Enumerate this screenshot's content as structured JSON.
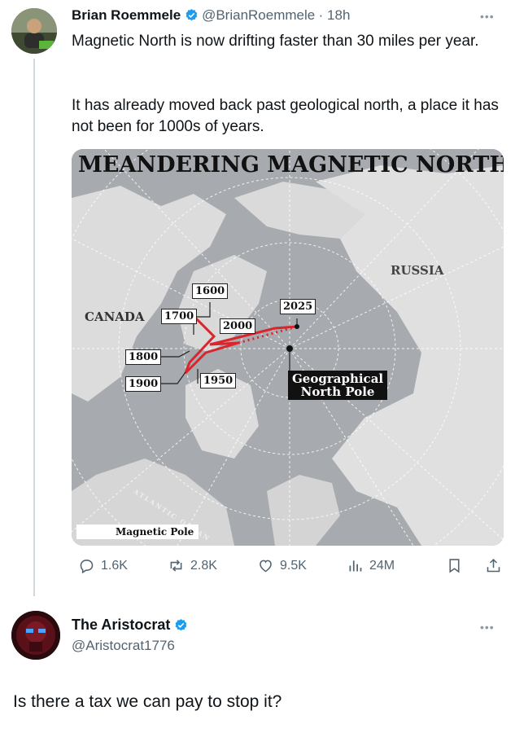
{
  "tweet": {
    "author_name": "Brian Roemmele",
    "author_handle": "@BrianRoemmele",
    "time": "· 18h",
    "text_p1": "Magnetic North is now drifting faster than 30 miles per year.",
    "text_p2": "It has already moved back past geological north, a place it has not been for 1000s of years.",
    "image": {
      "title": "MEANDERING MAGNETIC NORTH",
      "labels": {
        "canada": "CANADA",
        "russia": "RUSSIA",
        "atlantic": "ATLANTIC OCEAN",
        "geo_line1": "Geographical",
        "geo_line2": "North Pole",
        "y1600": "1600",
        "y1700": "1700",
        "y1800": "1800",
        "y1900": "1900",
        "y1950": "1950",
        "y2000": "2000",
        "y2025": "2025",
        "legend": "Magnetic Pole"
      }
    },
    "actions": {
      "replies": "1.6K",
      "reposts": "2.8K",
      "likes": "9.5K",
      "views": "24M"
    }
  },
  "reply": {
    "author_name": "The Aristocrat",
    "author_handle": "@Aristocrat1776",
    "text": "Is there a tax we can pay to stop it?"
  },
  "colors": {
    "verified": "#1d9bf0",
    "muted": "#536471",
    "thread_line": "#cfd9de",
    "pole_path": "#d8262c"
  },
  "icons": [
    "more-icon",
    "verified-icon",
    "reply-icon",
    "repost-icon",
    "like-icon",
    "views-icon",
    "bookmark-icon",
    "share-icon"
  ]
}
